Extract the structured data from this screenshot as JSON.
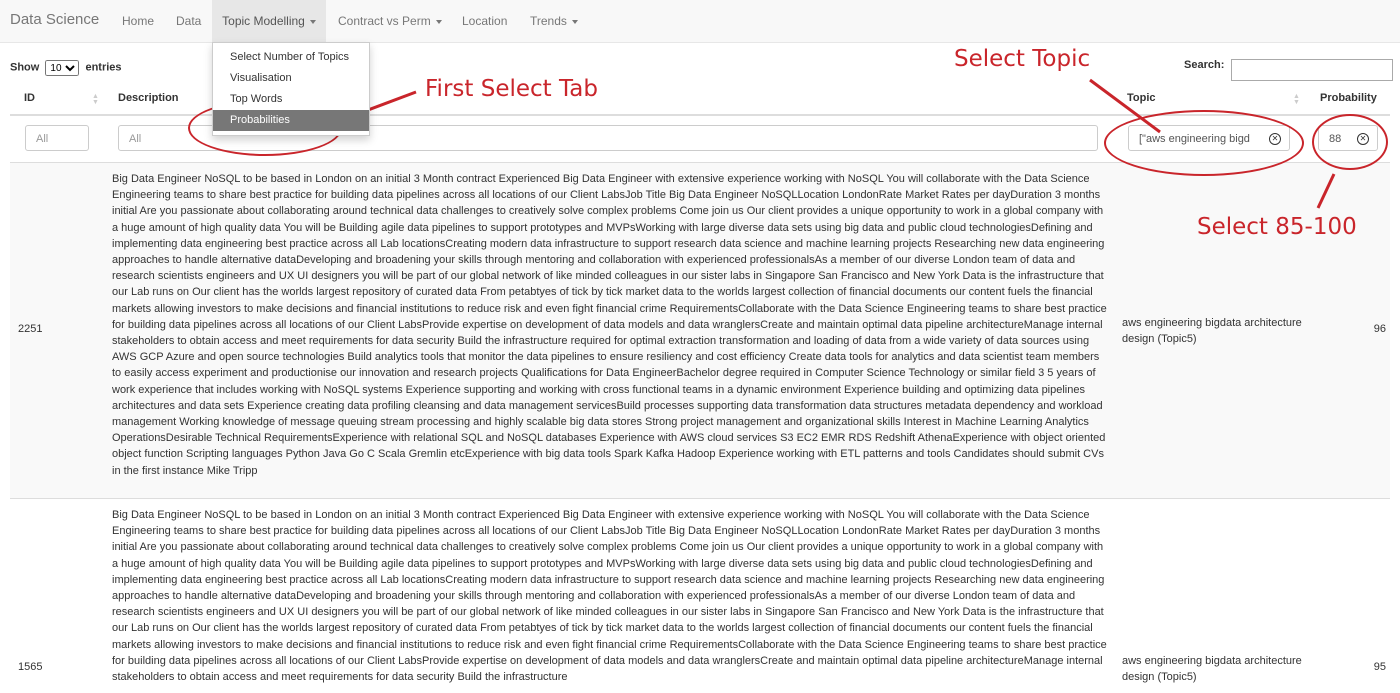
{
  "nav": {
    "brand": "Data Science",
    "items": [
      "Home",
      "Data",
      "Topic Modelling",
      "Contract vs Perm",
      "Location",
      "Trends"
    ],
    "dropdown": [
      "Select Number of Topics",
      "Visualisation",
      "Top Words",
      "Probabilities"
    ]
  },
  "controls": {
    "show_label": "Show",
    "show_value": "10",
    "entries_label": "entries",
    "search_label": "Search:"
  },
  "table": {
    "headers": [
      "ID",
      "Description",
      "Topic",
      "Probability"
    ],
    "filters": {
      "id_placeholder": "All",
      "desc_placeholder": "All",
      "topic_value": "[\"aws engineering bigd",
      "prob_value": "88"
    },
    "rows": [
      {
        "id": "2251",
        "description": "Big Data Engineer NoSQL to be based in London on an initial 3 Month contract Experienced Big Data Engineer with extensive experience working with NoSQL You will collaborate with the Data Science Engineering teams to share best practice for building data pipelines across all locations of our Client LabsJob Title Big Data Engineer NoSQLLocation LondonRate Market Rates per dayDuration 3 months initial Are you passionate about collaborating around technical data challenges to creatively solve complex problems Come join us Our client provides a unique opportunity to work in a global company with a huge amount of high quality data You will be Building agile data pipelines to support prototypes and MVPsWorking with large diverse data sets using big data and public cloud technologiesDefining and implementing data engineering best practice across all Lab locationsCreating modern data infrastructure to support research data science and machine learning projects Researching new data engineering approaches to handle alternative dataDeveloping and broadening your skills through mentoring and collaboration with experienced professionalsAs a member of our diverse London team of data and research scientists engineers and UX UI designers you will be part of our global network of like minded colleagues in our sister labs in Singapore San Francisco and New York Data is the infrastructure that our Lab runs on Our client has the worlds largest repository of curated data From petabtyes of tick by tick market data to the worlds largest collection of financial documents our content fuels the financial markets allowing investors to make decisions and financial institutions to reduce risk and even fight financial crime RequirementsCollaborate with the Data Science Engineering teams to share best practice for building data pipelines across all locations of our Client LabsProvide expertise on development of data models and data wranglersCreate and maintain optimal data pipeline architectureManage internal stakeholders to obtain access and meet requirements for data security Build the infrastructure required for optimal extraction transformation and loading of data from a wide variety of data sources using AWS GCP Azure and open source technologies Build analytics tools that monitor the data pipelines to ensure resiliency and cost efficiency Create data tools for analytics and data scientist team members to easily access experiment and productionise our innovation and research projects Qualifications for Data EngineerBachelor degree required in Computer Science Technology or similar field 3 5 years of work experience that includes working with NoSQL systems Experience supporting and working with cross functional teams in a dynamic environment Experience building and optimizing data pipelines architectures and data sets Experience creating data profiling cleansing and data management servicesBuild processes supporting data transformation data structures metadata dependency and workload management Working knowledge of message queuing stream processing and highly scalable big data stores Strong project management and organizational skills Interest in Machine Learning Analytics OperationsDesirable Technical RequirementsExperience with relational SQL and NoSQL databases Experience with AWS cloud services S3 EC2 EMR RDS Redshift AthenaExperience with object oriented object function Scripting languages Python Java Go C Scala Gremlin etcExperience with big data tools Spark Kafka Hadoop Experience working with ETL patterns and tools Candidates should submit CVs in the first instance Mike Tripp",
        "topic": "aws engineering bigdata architecture design (Topic5)",
        "probability": "96"
      },
      {
        "id": "1565",
        "description": "Big Data Engineer NoSQL to be based in London on an initial 3 Month contract Experienced Big Data Engineer with extensive experience working with NoSQL You will collaborate with the Data Science Engineering teams to share best practice for building data pipelines across all locations of our Client LabsJob Title Big Data Engineer NoSQLLocation LondonRate Market Rates per dayDuration 3 months initial Are you passionate about collaborating around technical data challenges to creatively solve complex problems Come join us Our client provides a unique opportunity to work in a global company with a huge amount of high quality data You will be Building agile data pipelines to support prototypes and MVPsWorking with large diverse data sets using big data and public cloud technologiesDefining and implementing data engineering best practice across all Lab locationsCreating modern data infrastructure to support research data science and machine learning projects Researching new data engineering approaches to handle alternative dataDeveloping and broadening your skills through mentoring and collaboration with experienced professionalsAs a member of our diverse London team of data and research scientists engineers and UX UI designers you will be part of our global network of like minded colleagues in our sister labs in Singapore San Francisco and New York Data is the infrastructure that our Lab runs on Our client has the worlds largest repository of curated data From petabtyes of tick by tick market data to the worlds largest collection of financial documents our content fuels the financial markets allowing investors to make decisions and financial institutions to reduce risk and even fight financial crime RequirementsCollaborate with the Data Science Engineering teams to share best practice for building data pipelines across all locations of our Client LabsProvide expertise on development of data models and data wranglersCreate and maintain optimal data pipeline architectureManage internal stakeholders to obtain access and meet requirements for data security Build the infrastructure",
        "topic": "aws engineering bigdata architecture design (Topic5)",
        "probability": "95"
      }
    ]
  },
  "annotations": {
    "first": "First Select Tab",
    "topic": "Select Topic",
    "prob": "Select 85-100",
    "color": "#c9252b"
  }
}
